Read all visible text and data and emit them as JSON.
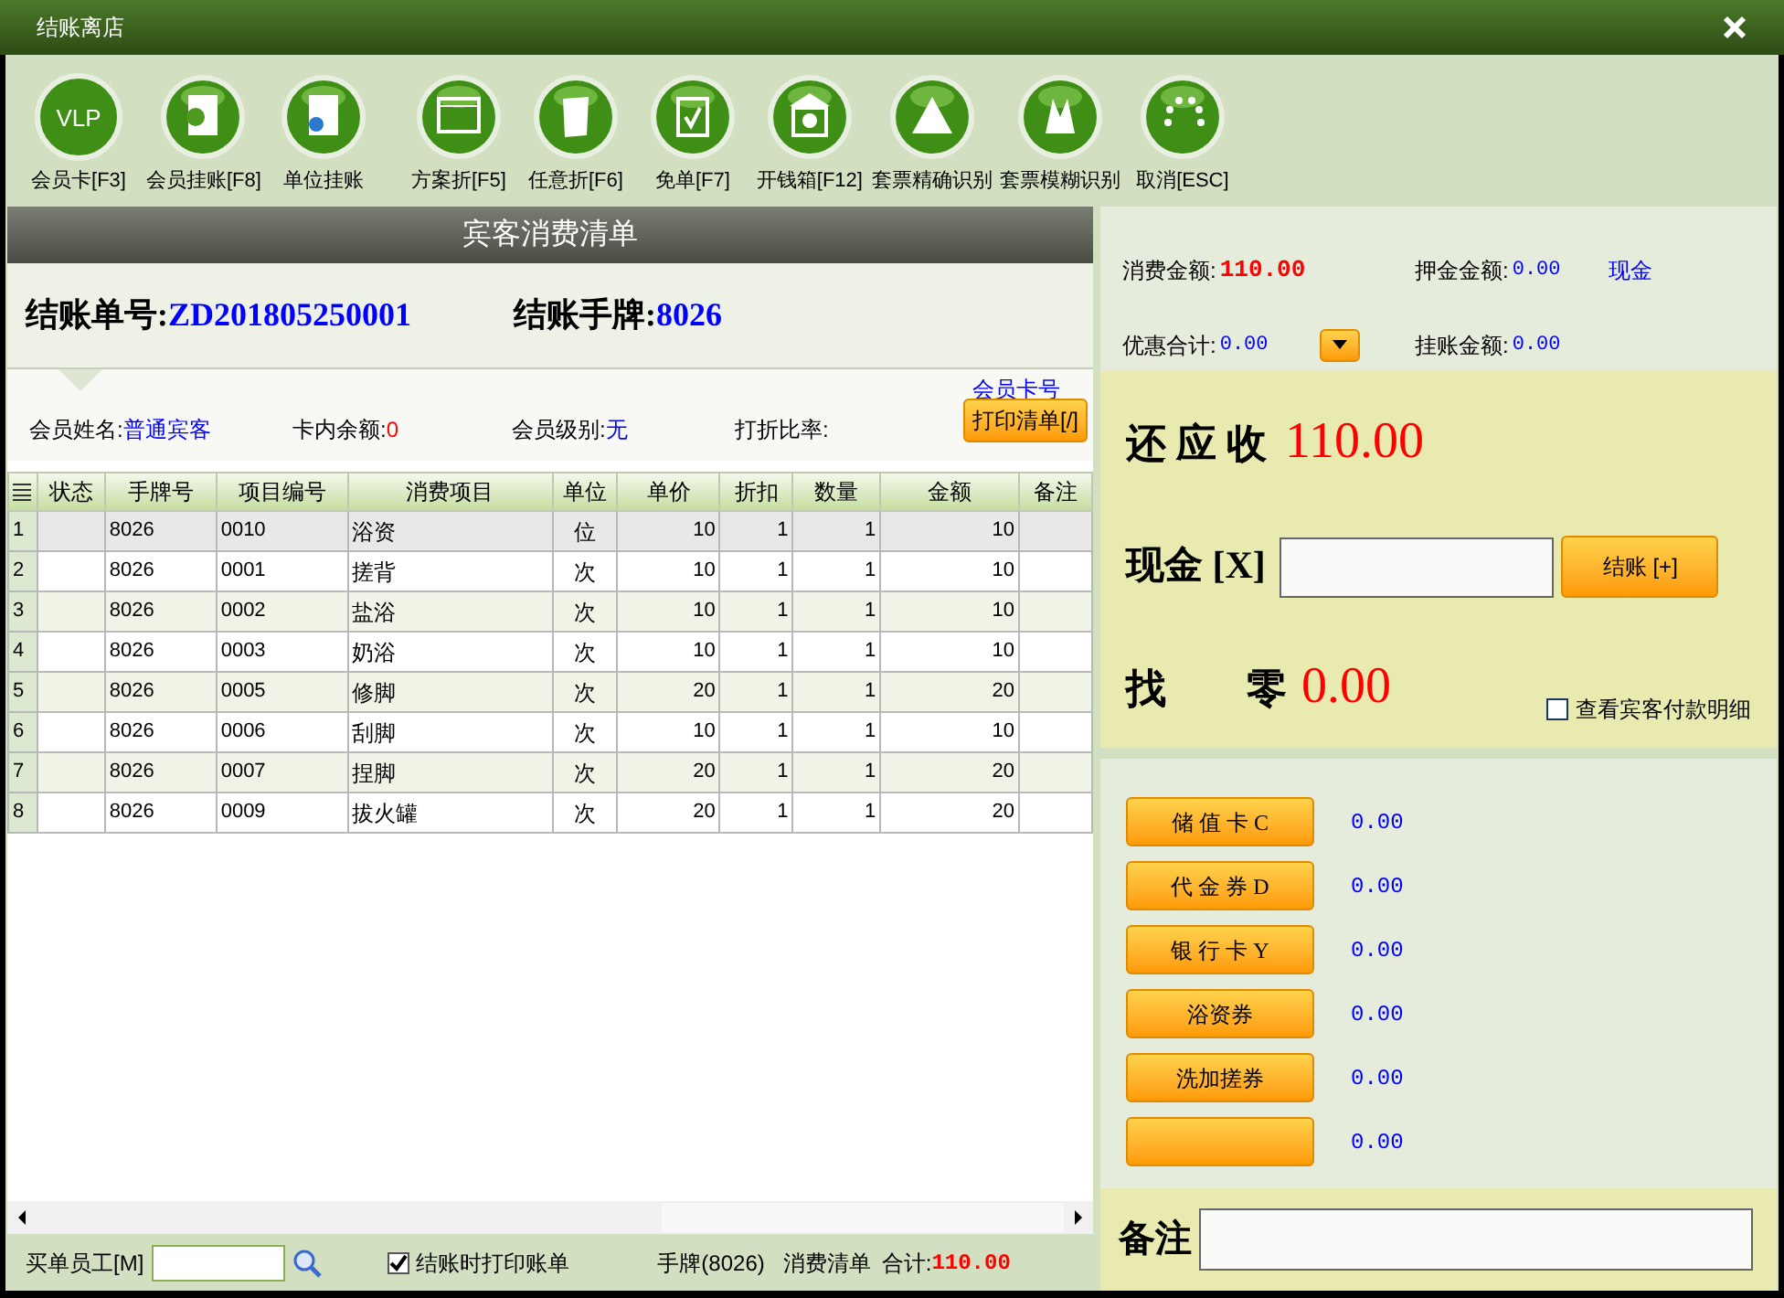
{
  "window": {
    "title": "结账离店"
  },
  "toolbar": [
    {
      "label": "会员卡[F3]",
      "icon_text": "VLP"
    },
    {
      "label": "会员挂账[F8]"
    },
    {
      "label": "单位挂账"
    },
    {
      "label": "方案折[F5]"
    },
    {
      "label": "任意折[F6]"
    },
    {
      "label": "免单[F7]"
    },
    {
      "label": "开钱箱[F12]"
    },
    {
      "label": "套票精确识别"
    },
    {
      "label": "套票模糊识别"
    },
    {
      "label": "取消[ESC]"
    }
  ],
  "bill": {
    "title": "宾客消费清单",
    "order_label": "结账单号:",
    "order_no": "ZD201805250001",
    "tag_label": "结账手牌:",
    "tag_no": "8026",
    "member_card_link": "会员卡号",
    "print_button": "打印清单[/]",
    "fields": [
      {
        "label": "会员姓名:",
        "value": "普通宾客",
        "color": "#0000ff"
      },
      {
        "label": "卡内余额:",
        "value": "0",
        "color": "#ff0000"
      },
      {
        "label": "会员级别:",
        "value": "无",
        "color": "#0000ff"
      },
      {
        "label": "打折比率:"
      }
    ]
  },
  "table": {
    "columns": [
      "状态",
      "手牌号",
      "项目编号",
      "消费项目",
      "单位",
      "单价",
      "折扣",
      "数量",
      "金额",
      "备注"
    ],
    "rows": [
      {
        "n": "1",
        "cells": [
          "",
          "8026",
          "0010",
          "浴资",
          "位",
          "10",
          "1",
          "1",
          "10",
          ""
        ],
        "selected": true
      },
      {
        "n": "2",
        "cells": [
          "",
          "8026",
          "0001",
          "搓背",
          "次",
          "10",
          "1",
          "1",
          "10",
          ""
        ],
        "selected": false
      },
      {
        "n": "3",
        "cells": [
          "",
          "8026",
          "0002",
          "盐浴",
          "次",
          "10",
          "1",
          "1",
          "10",
          ""
        ],
        "selected": false
      },
      {
        "n": "4",
        "cells": [
          "",
          "8026",
          "0003",
          "奶浴",
          "次",
          "10",
          "1",
          "1",
          "10",
          ""
        ],
        "selected": false
      },
      {
        "n": "5",
        "cells": [
          "",
          "8026",
          "0005",
          "修脚",
          "次",
          "20",
          "1",
          "1",
          "20",
          ""
        ],
        "selected": false
      },
      {
        "n": "6",
        "cells": [
          "",
          "8026",
          "0006",
          "刮脚",
          "次",
          "10",
          "1",
          "1",
          "10",
          ""
        ],
        "selected": false
      },
      {
        "n": "7",
        "cells": [
          "",
          "8026",
          "0007",
          "捏脚",
          "次",
          "20",
          "1",
          "1",
          "20",
          ""
        ],
        "selected": false
      },
      {
        "n": "8",
        "cells": [
          "",
          "8026",
          "0009",
          "拔火罐",
          "次",
          "20",
          "1",
          "1",
          "20",
          ""
        ],
        "selected": false
      }
    ]
  },
  "bottom_bar": {
    "staff_label": "买单员工[M]",
    "print_on_checkout": {
      "label": "结账时打印账单",
      "checked": true
    },
    "summary_tag": "手牌(8026)",
    "summary_list": "消费清单",
    "total_label": "合计:",
    "total": "110.00"
  },
  "summary": {
    "consumption_label": "消费金额:",
    "consumption": "110.00",
    "deposit_label": "押金金额:",
    "deposit": "0.00",
    "deposit_method": "现金",
    "discount_label": "优惠合计:",
    "discount": "0.00",
    "credit_label": "挂账金额:",
    "credit": "0.00"
  },
  "payment": {
    "due_label": "还 应 收",
    "due": "110.00",
    "cash_label": "现金 [X]",
    "checkout_button": "结账 [+]",
    "change_label": "找　　零",
    "change": "0.00",
    "show_details": {
      "label": "查看宾客付款明细",
      "checked": false
    }
  },
  "methods": [
    {
      "label": "储 值 卡 C",
      "amount": "0.00"
    },
    {
      "label": "代 金 券 D",
      "amount": "0.00"
    },
    {
      "label": "银 行 卡 Y",
      "amount": "0.00"
    },
    {
      "label": "浴资券",
      "amount": "0.00"
    },
    {
      "label": "洗加搓券",
      "amount": "0.00"
    },
    {
      "amount": "0.00"
    }
  ],
  "notes": {
    "label": "备注"
  }
}
